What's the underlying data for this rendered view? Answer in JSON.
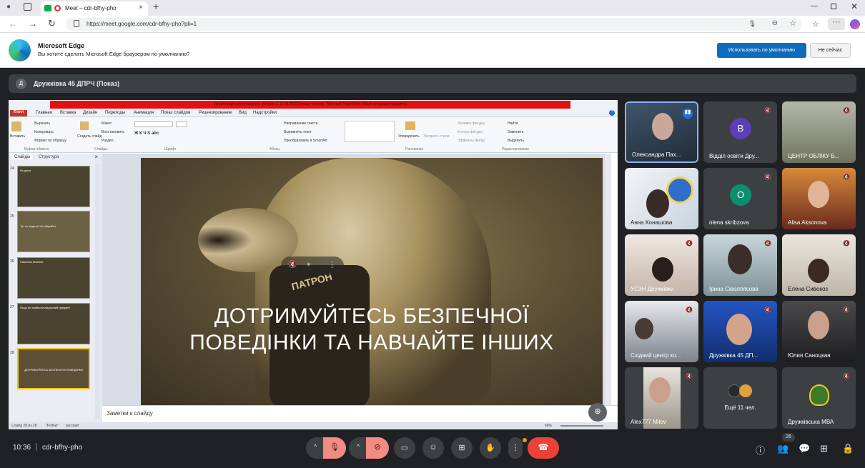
{
  "browser": {
    "tab_title": "Meet – cdr-bfhy-pho",
    "url": "https://meet.google.com/cdr-bfhy-pho?pli=1"
  },
  "infobar": {
    "title": "Microsoft Edge",
    "message": "Вы хотите сделать Microsoft Edge браузером по умолчанию?",
    "primary_button": "Использовать по умолчанию",
    "secondary_button": "Не сейчас"
  },
  "meeting": {
    "avatar_letter": "Д",
    "presenter_title": "Дружківка 45 ДПРЧ (Показ)",
    "time": "10:36",
    "code": "cdr-bfhy-pho",
    "participant_count": "26"
  },
  "powerpoint": {
    "window_title": "Презентация для учащихся, учитель 1, 11.06.2022 [только чтение] - Microsoft PowerPoint (Сбой активации продукта)",
    "menu": [
      "Файл",
      "Главная",
      "Вставка",
      "Дизайн",
      "Переходы",
      "Анимация",
      "Показ слайдов",
      "Рецензирование",
      "Вид",
      "Надстройки"
    ],
    "ribbon_groups": [
      "Буфер обмена",
      "Слайды",
      "Шрифт",
      "Абзац",
      "Рисование",
      "Редактирование"
    ],
    "ribbon_items": {
      "paste": "Вставить",
      "cut": "Вырезать",
      "copy": "Копировать",
      "format": "Формат по образцу",
      "new_slide": "Создать слайд",
      "layout": "Макет",
      "reset": "Восстановить",
      "section": "Раздел",
      "text_direction": "Направление текста",
      "align_text": "Выровнять текст",
      "smartart": "Преобразовать в SmartArt",
      "arrange": "Упорядочить",
      "quick_styles": "Экспресс-стили",
      "shape_fill": "Заливка фигуры",
      "shape_outline": "Контур фигуры",
      "shape_effects": "Эффекты фигур",
      "find": "Найти",
      "replace": "Заменить",
      "select": "Выделить"
    },
    "panel_tabs": [
      "Слайды",
      "Структура"
    ],
    "thumbs": [
      {
        "num": "24",
        "title": "Як діяти"
      },
      {
        "num": "25",
        "title": "Тут не ходять! Не збирайте"
      },
      {
        "num": "26",
        "title": "Пам'ятка безпеки"
      },
      {
        "num": "27",
        "title": "Якщо ви знайшли підозрілий предмет"
      },
      {
        "num": "28",
        "title": "ДОТРИМУЙТЕСЬ БЕЗПЕЧНОЇ ПОВЕДІНКИ"
      }
    ],
    "slide_text_line1": "ДОТРИМУЙТЕСЬ БЕЗПЕЧНОЇ",
    "slide_text_line2": "ПОВЕДІНКИ ТА НАВЧАЙТЕ ІНШИХ",
    "harness_text": "ПАТРОН",
    "notes_placeholder": "Заметки к слайду",
    "status": {
      "slide": "Слайд 28 из 28",
      "theme": "\"Follow\"",
      "lang": "русский",
      "zoom": "66%"
    }
  },
  "participants": [
    {
      "name": "Олександра Пах...",
      "type": "photo",
      "bg": "#2b3a4a",
      "speaking": true
    },
    {
      "name": "Відділ освіти Дру...",
      "type": "avatar",
      "letter": "В",
      "color": "#5a3fb5"
    },
    {
      "name": "ЦЕНТР ОБЛІКУ Б...",
      "type": "photo",
      "bg": "#8a8f7c"
    },
    {
      "name": "Анна Конашова",
      "type": "photo",
      "bg": "#dfe4ea"
    },
    {
      "name": "olena skribzova",
      "type": "avatar",
      "letter": "O",
      "color": "#0a8f6f"
    },
    {
      "name": "Alisa Aksonova",
      "type": "photo",
      "bg": "#7a3a2a"
    },
    {
      "name": "УСЗН Дружківки",
      "type": "photo",
      "bg": "#d8c9c0"
    },
    {
      "name": "Ірина Сіволпясова",
      "type": "photo",
      "bg": "#8fa0a8"
    },
    {
      "name": "Елена Сивокоз",
      "type": "photo",
      "bg": "#d7d2c8"
    },
    {
      "name": "Східний центр ко...",
      "type": "photo",
      "bg": "#b9bcc2"
    },
    {
      "name": "Дружківка 45 ДП...",
      "type": "photo",
      "bg": "#1d47a8"
    },
    {
      "name": "Юлия Саноцкая",
      "type": "photo",
      "bg": "#3e3e40"
    },
    {
      "name": "Alex777 Milov",
      "type": "photo",
      "bg": "#b8b2a8"
    },
    {
      "name": "Ещё 11 чел.",
      "type": "more"
    },
    {
      "name": "Дружківська МВА",
      "type": "emblem"
    }
  ],
  "colors": {
    "accent": "#8ab4f8",
    "end_call": "#ea4335",
    "muted_bg": "#f28b82",
    "slide_tint": "#c9a45a"
  }
}
